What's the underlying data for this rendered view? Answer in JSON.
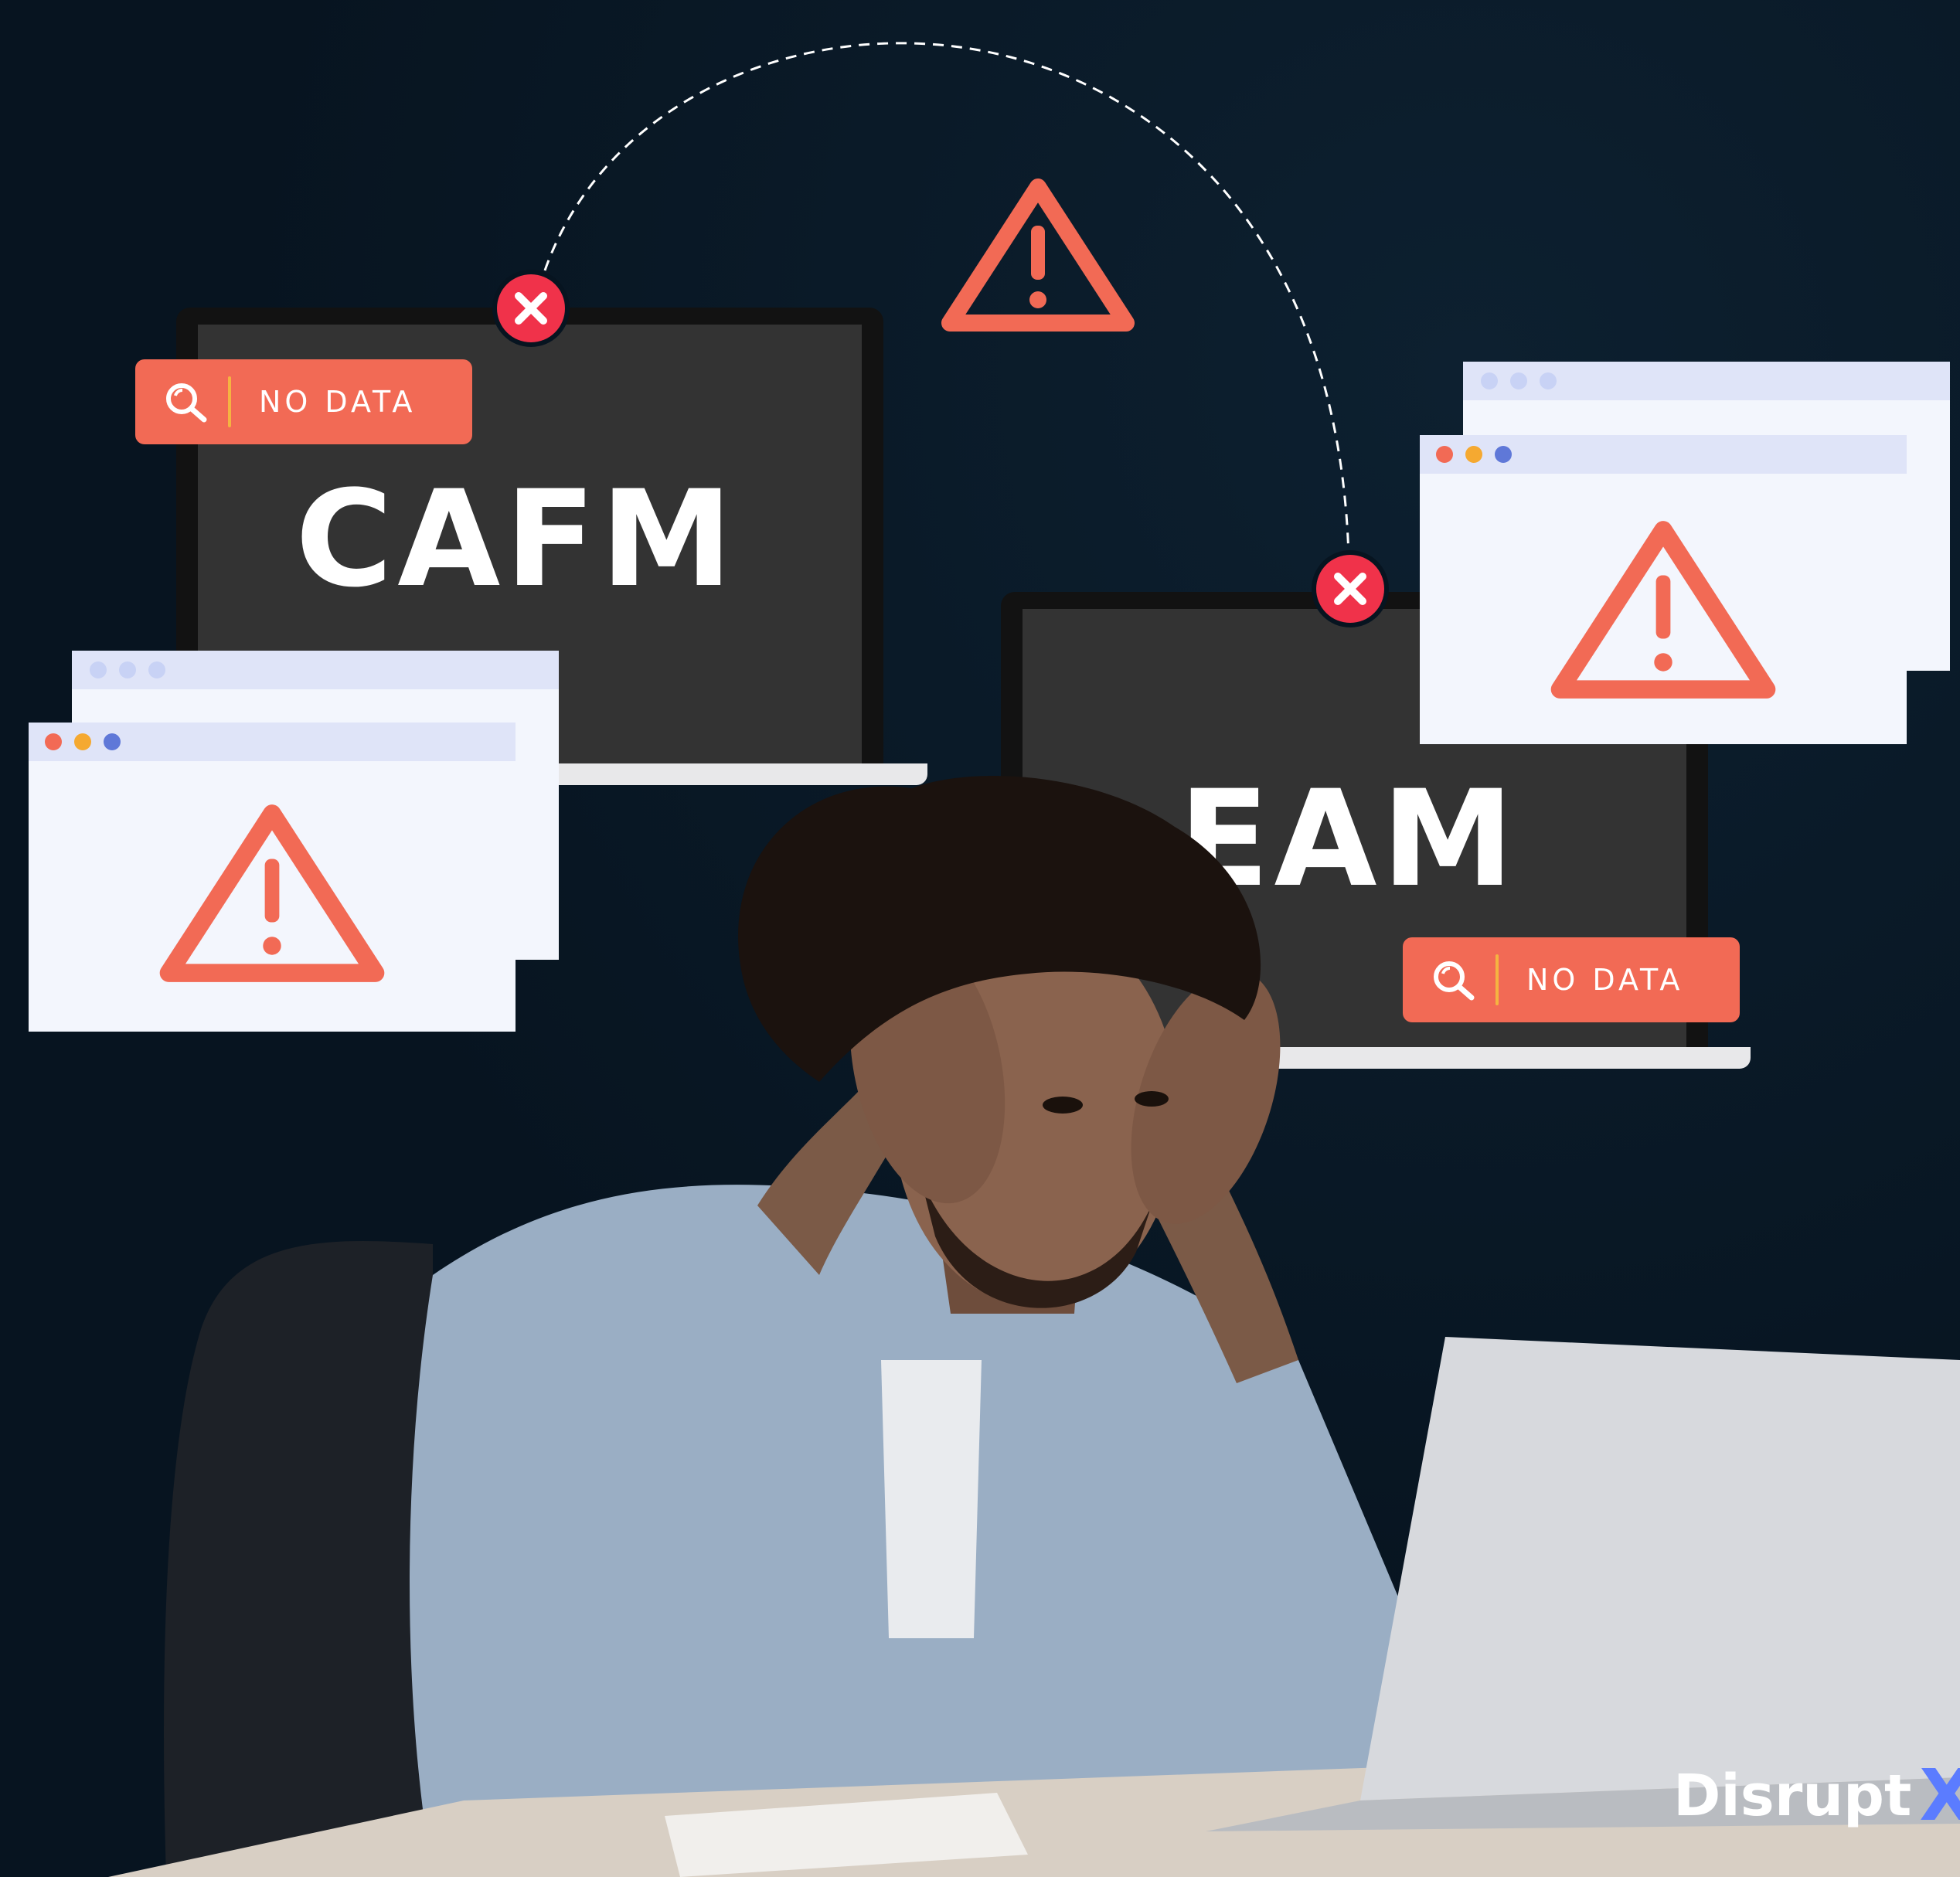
{
  "colors": {
    "background": "#071420",
    "accent": "#f26a55",
    "error": "#f0324a",
    "divider": "#f5b341",
    "window": "#f3f6fd",
    "window_bar": "#dfe4f8"
  },
  "systems": {
    "cafm": {
      "label": "CAFM",
      "search_text": "NO DATA"
    },
    "eam": {
      "label": "EAM",
      "search_text": "NO DATA"
    }
  },
  "icons": [
    "search-icon",
    "warning-icon",
    "error-x-icon"
  ],
  "brand": {
    "logo_text": "Disrupt",
    "logo_mark": "X"
  }
}
